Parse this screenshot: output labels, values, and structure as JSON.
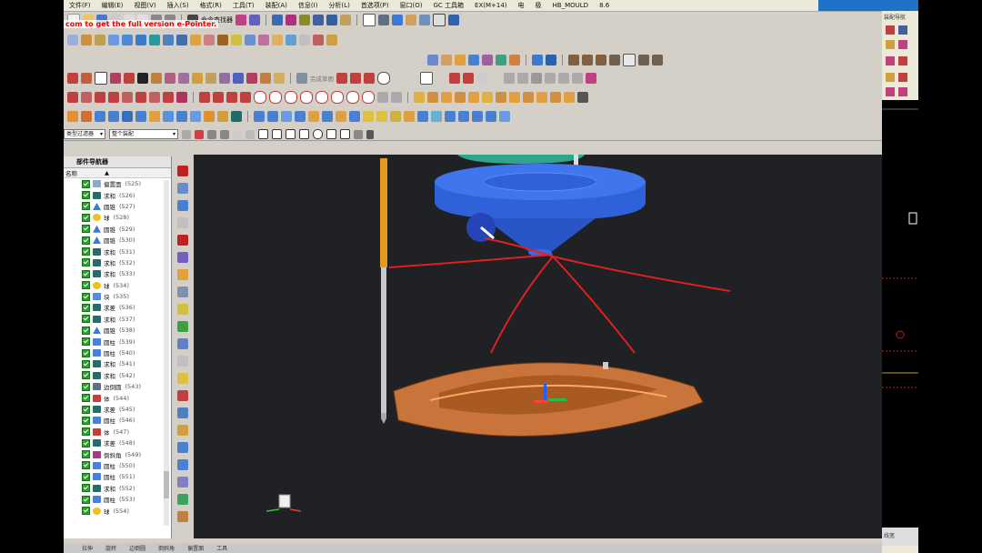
{
  "menu": [
    "文件(F)",
    "编辑(E)",
    "视图(V)",
    "插入(S)",
    "格式(R)",
    "工具(T)",
    "装配(A)",
    "信息(I)",
    "分析(L)",
    "首选项(P)",
    "窗口(O)",
    "GC 工具箱",
    "EX(M+14)",
    "电",
    "极",
    "HB_MOULD",
    "8.6"
  ],
  "watermark": "com to get the full version e-Pointer.",
  "toolbar": {
    "command_finder": "命令查找器",
    "feature_label": "完成草图"
  },
  "filter": {
    "type_filter": "类型过滤器",
    "scope": "整个装配"
  },
  "navigator": {
    "title": "部件导航器",
    "column_name": "名称",
    "items": [
      {
        "name": "偏置面",
        "id": "(525)",
        "icon": "face-icon",
        "color": "#8fa8c8"
      },
      {
        "name": "求和",
        "id": "(526)",
        "icon": "unite-icon",
        "color": "#2a6a6a"
      },
      {
        "name": "圆锥",
        "id": "(527)",
        "icon": "cone-icon",
        "color": "#3a7ad0"
      },
      {
        "name": "球",
        "id": "(528)",
        "icon": "sphere-icon",
        "color": "#f0c020"
      },
      {
        "name": "圆锥",
        "id": "(529)",
        "icon": "cone-icon",
        "color": "#3a7ad0"
      },
      {
        "name": "圆锥",
        "id": "(530)",
        "icon": "cone-icon",
        "color": "#3a7ad0"
      },
      {
        "name": "求和",
        "id": "(531)",
        "icon": "unite-icon",
        "color": "#2a6a6a"
      },
      {
        "name": "求和",
        "id": "(532)",
        "icon": "unite-icon",
        "color": "#2a6a6a"
      },
      {
        "name": "求和",
        "id": "(533)",
        "icon": "unite-icon",
        "color": "#2a6a6a"
      },
      {
        "name": "球",
        "id": "(534)",
        "icon": "sphere-icon",
        "color": "#f0c020"
      },
      {
        "name": "块",
        "id": "(535)",
        "icon": "block-icon",
        "color": "#5a8ad8"
      },
      {
        "name": "求差",
        "id": "(536)",
        "icon": "subtract-icon",
        "color": "#2a6a6a"
      },
      {
        "name": "求和",
        "id": "(537)",
        "icon": "unite-icon",
        "color": "#2a6a6a"
      },
      {
        "name": "圆锥",
        "id": "(538)",
        "icon": "cone-icon",
        "color": "#3a7ad0"
      },
      {
        "name": "圆柱",
        "id": "(539)",
        "icon": "cylinder-icon",
        "color": "#4a80d8"
      },
      {
        "name": "圆柱",
        "id": "(540)",
        "icon": "cylinder-icon",
        "color": "#4a80d8"
      },
      {
        "name": "求和",
        "id": "(541)",
        "icon": "unite-icon",
        "color": "#2a6a6a"
      },
      {
        "name": "求和",
        "id": "(542)",
        "icon": "unite-icon",
        "color": "#2a6a6a"
      },
      {
        "name": "边倒圆",
        "id": "(543)",
        "icon": "blend-icon",
        "color": "#607080"
      },
      {
        "name": "体",
        "id": "(544)",
        "icon": "body-icon",
        "color": "#c04040"
      },
      {
        "name": "求差",
        "id": "(545)",
        "icon": "subtract-icon",
        "color": "#2a6a6a"
      },
      {
        "name": "圆柱",
        "id": "(546)",
        "icon": "cylinder-icon",
        "color": "#4a80d8"
      },
      {
        "name": "体",
        "id": "(547)",
        "icon": "body-icon",
        "color": "#c04040"
      },
      {
        "name": "求差",
        "id": "(548)",
        "icon": "subtract-icon",
        "color": "#2a6a6a"
      },
      {
        "name": "倒斜角",
        "id": "(549)",
        "icon": "chamfer-icon",
        "color": "#a04080"
      },
      {
        "name": "圆柱",
        "id": "(550)",
        "icon": "cylinder-icon",
        "color": "#4a80d8"
      },
      {
        "name": "圆柱",
        "id": "(551)",
        "icon": "cylinder-icon",
        "color": "#4a80d8"
      },
      {
        "name": "求和",
        "id": "(552)",
        "icon": "unite-icon",
        "color": "#2a6a6a"
      },
      {
        "name": "圆柱",
        "id": "(553)",
        "icon": "cylinder-icon",
        "color": "#4a80d8"
      },
      {
        "name": "球",
        "id": "(554)",
        "icon": "sphere-icon",
        "color": "#f0c020"
      }
    ]
  },
  "status": [
    "拉伸",
    "旋转",
    "边倒圆",
    "倒斜角",
    "偏置面",
    "工具"
  ],
  "right_panel": {
    "tab1": "装配导航",
    "tab2": "线宽"
  },
  "colors": {
    "viewport_bg": "#1f2124",
    "annotation": "#e02020",
    "part_blue": "#2f62d8",
    "fixture_orange": "#c8743a",
    "accent_blue": "#1e73c8"
  }
}
